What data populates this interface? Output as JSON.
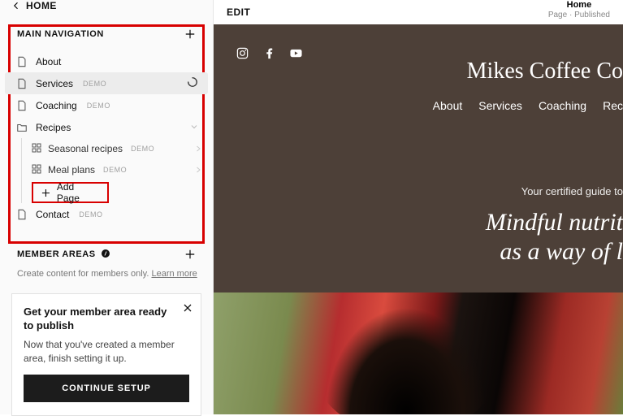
{
  "sidebar": {
    "back_label": "HOME",
    "section_title": "MAIN NAVIGATION",
    "items": [
      {
        "label": "About",
        "demo": ""
      },
      {
        "label": "Services",
        "demo": "DEMO"
      },
      {
        "label": "Coaching",
        "demo": "DEMO"
      },
      {
        "label": "Recipes",
        "demo": ""
      },
      {
        "label": "Contact",
        "demo": "DEMO"
      }
    ],
    "recipes_children": [
      {
        "label": "Seasonal recipes",
        "demo": "DEMO"
      },
      {
        "label": "Meal plans",
        "demo": "DEMO"
      }
    ],
    "add_page_label": "Add Page",
    "member": {
      "title": "MEMBER AREAS",
      "subtitle_prefix": "Create content for members only. ",
      "subtitle_link": "Learn more"
    },
    "card": {
      "title": "Get your member area ready to publish",
      "body": "Now that you've created a member area, finish setting it up.",
      "button": "CONTINUE SETUP"
    }
  },
  "main": {
    "edit_label": "EDIT",
    "status_title": "Home",
    "status_sub": "Page · Published"
  },
  "preview": {
    "site_title": "Mikes Coffee Co",
    "nav": [
      "About",
      "Services",
      "Coaching",
      "Rec"
    ],
    "tagline": "Your certified guide to",
    "headline1": "Mindful nutrit",
    "headline2": "as a way of l"
  }
}
